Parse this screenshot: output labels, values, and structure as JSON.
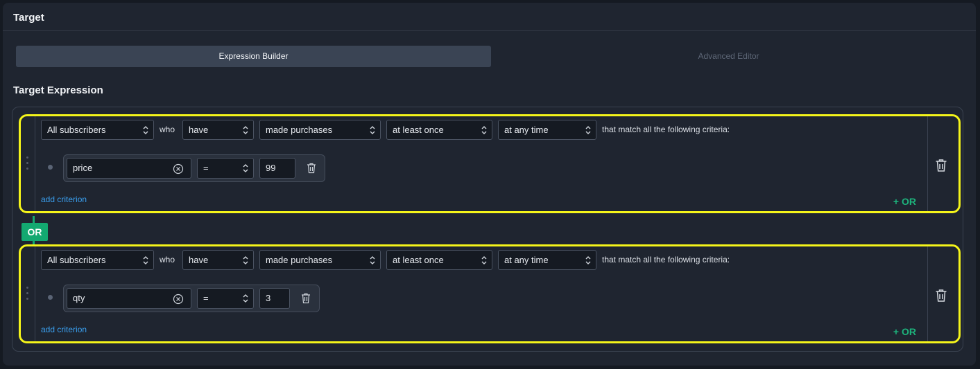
{
  "panel": {
    "title": "Target"
  },
  "tabs": [
    {
      "label": "Expression Builder",
      "active": true
    },
    {
      "label": "Advanced Editor",
      "active": false
    }
  ],
  "section_title": "Target Expression",
  "connector": "OR",
  "groups": [
    {
      "audience": "All subscribers",
      "who": "who",
      "verb": "have",
      "action": "made purchases",
      "frequency": "at least once",
      "timeframe": "at any time",
      "suffix": "that match all the following criteria:",
      "criterion": {
        "field": "price",
        "operator": "=",
        "value": "99"
      },
      "add_label": "add criterion",
      "or_label": "+ OR"
    },
    {
      "audience": "All subscribers",
      "who": "who",
      "verb": "have",
      "action": "made purchases",
      "frequency": "at least once",
      "timeframe": "at any time",
      "suffix": "that match all the following criteria:",
      "criterion": {
        "field": "qty",
        "operator": "=",
        "value": "3"
      },
      "add_label": "add criterion",
      "or_label": "+ OR"
    }
  ],
  "colors": {
    "highlight": "#f5f51a",
    "accent_green": "#13a971",
    "link_blue": "#3aa0f0"
  }
}
